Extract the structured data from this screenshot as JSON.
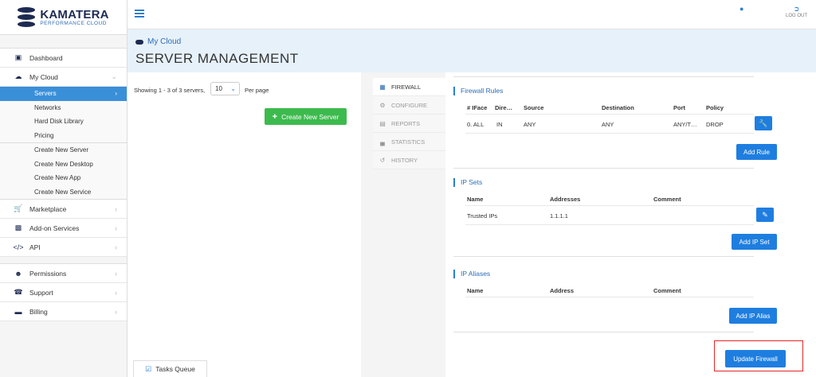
{
  "brand": {
    "name": "KAMATERA",
    "tagline": "PERFORMANCE CLOUD"
  },
  "topbar": {
    "logout_label": "LOG OUT",
    "user_icon": "user-icon",
    "logout_icon": "logout-icon"
  },
  "sidebar": {
    "dashboard": "Dashboard",
    "my_cloud": "My Cloud",
    "my_cloud_items": [
      "Servers",
      "Networks",
      "Hard Disk Library",
      "Pricing"
    ],
    "create_items": [
      "Create New Server",
      "Create New Desktop",
      "Create New App",
      "Create New Service"
    ],
    "marketplace": "Marketplace",
    "addon": "Add-on Services",
    "api": "API",
    "permissions": "Permissions",
    "support": "Support",
    "billing": "Billing"
  },
  "header": {
    "breadcrumb": "My Cloud",
    "title": "SERVER MANAGEMENT"
  },
  "servers": {
    "showing": "Showing 1 - 3 of 3 servers,",
    "per_page_value": "10",
    "per_page_label": "Per page",
    "create_button": "Create New Server"
  },
  "tasks_queue": "Tasks Queue",
  "tabs": [
    "FIREWALL",
    "CONFIGURE",
    "REPORTS",
    "STATISTICS",
    "HISTORY"
  ],
  "firewall_rules": {
    "title": "Firewall Rules",
    "headers": [
      "# IFace",
      "Dire…",
      "Source",
      "Destination",
      "Port",
      "Policy"
    ],
    "rows": [
      [
        "0. ALL",
        "IN",
        "ANY",
        "ANY",
        "ANY/T…",
        "DROP"
      ]
    ],
    "add_button": "Add Rule"
  },
  "ip_sets": {
    "title": "IP Sets",
    "headers": [
      "Name",
      "Addresses",
      "Comment"
    ],
    "rows": [
      [
        "Trusted IPs",
        "1.1.1.1",
        ""
      ]
    ],
    "add_button": "Add IP Set"
  },
  "ip_aliases": {
    "title": "IP Aliases",
    "headers": [
      "Name",
      "Address",
      "Comment"
    ],
    "add_button": "Add IP Alias"
  },
  "update_button": "Update Firewall",
  "colors": {
    "accent": "#1e7ee0",
    "success": "#3dba4e",
    "brand": "#1d2a52",
    "highlight": "#e32626"
  }
}
